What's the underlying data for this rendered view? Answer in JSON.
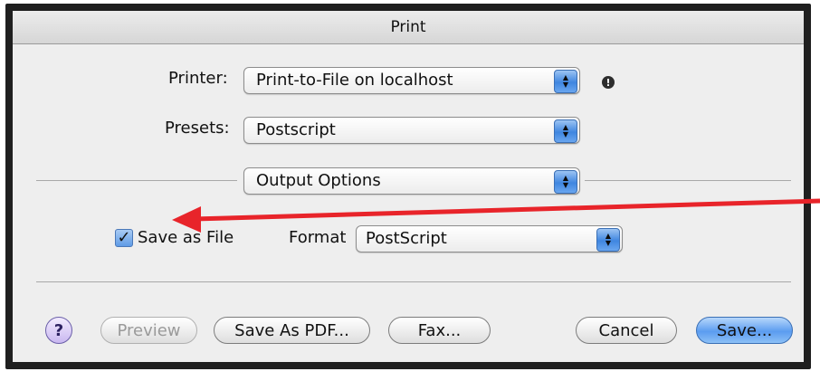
{
  "window": {
    "title": "Print"
  },
  "printer": {
    "label": "Printer:",
    "value": "Print-to-File on localhost"
  },
  "presets": {
    "label": "Presets:",
    "value": "Postscript"
  },
  "panel_select": {
    "value": "Output Options"
  },
  "output": {
    "save_as_file_label": "Save as File",
    "save_as_file_checked": true,
    "format_label": "Format",
    "format_value": "PostScript"
  },
  "buttons": {
    "help": "?",
    "preview": "Preview",
    "save_as_pdf": "Save As PDF...",
    "fax": "Fax...",
    "cancel": "Cancel",
    "save": "Save..."
  },
  "icons": {
    "info": "info-icon",
    "popup_arrows": "up-down-arrows-icon",
    "annotation": "red-arrow"
  },
  "colors": {
    "annotation_arrow": "#e8242a",
    "default_button": "#5b9cf0",
    "help_button": "#c9b7f0"
  }
}
